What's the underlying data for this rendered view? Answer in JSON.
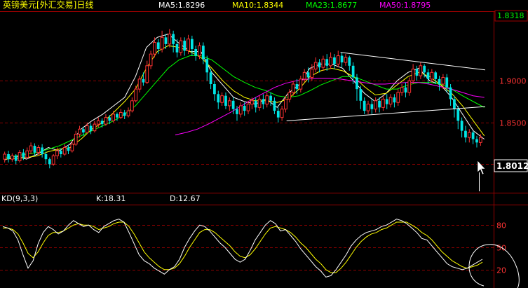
{
  "header": {
    "title": "英镑美元[外汇交易]日线",
    "ma_items": [
      {
        "label": "MA5:1.8296",
        "color": "#ffffff"
      },
      {
        "label": "MA10:1.8344",
        "color": "#ffff00"
      },
      {
        "label": "MA23:1.8677",
        "color": "#00ff00"
      },
      {
        "label": "MA50:1.8795",
        "color": "#ff00ff"
      }
    ]
  },
  "kd_header": {
    "name": "KD(9,3,3)",
    "k": "K:18.31",
    "d": "D:12.67"
  },
  "chart_data": [
    {
      "type": "candlestick",
      "price_axis": {
        "ticks": [
          1.9,
          1.85
        ],
        "tick_labels": [
          "1.9000",
          "1.8500"
        ],
        "ylim": [
          1.77,
          1.98
        ]
      },
      "last_price": "1.8318",
      "cursor_price": "1.8012",
      "grid": true,
      "series": [
        {
          "name": "MA5",
          "color": "#ffffff"
        },
        {
          "name": "MA10",
          "color": "#ffff00"
        },
        {
          "name": "MA23",
          "color": "#00ff00"
        },
        {
          "name": "MA50",
          "color": "#ff00ff"
        }
      ],
      "ma_paths": {
        "MA5": [
          [
            1.805,
            1.81,
            1.806,
            1.812,
            1.82,
            1.816,
            1.824,
            1.842,
            1.852,
            1.86,
            1.87,
            1.88,
            1.905,
            1.94,
            1.952,
            1.956,
            1.945,
            1.935,
            1.935,
            1.91,
            1.895,
            1.88,
            1.875,
            1.872,
            1.878,
            1.868,
            1.885,
            1.895,
            1.915,
            1.92,
            1.92,
            1.915,
            1.9,
            1.885,
            1.875,
            1.885,
            1.9,
            1.91,
            1.915,
            1.9,
            1.895,
            1.88,
            1.86,
            1.84,
            1.83
          ]
        ],
        "MA10": [
          [
            1.806,
            1.807,
            1.808,
            1.81,
            1.815,
            1.818,
            1.82,
            1.83,
            1.842,
            1.85,
            1.862,
            1.875,
            1.89,
            1.915,
            1.935,
            1.942,
            1.94,
            1.935,
            1.928,
            1.915,
            1.9,
            1.888,
            1.88,
            1.876,
            1.876,
            1.874,
            1.878,
            1.89,
            1.905,
            1.912,
            1.915,
            1.912,
            1.905,
            1.893,
            1.883,
            1.885,
            1.895,
            1.905,
            1.91,
            1.905,
            1.895,
            1.885,
            1.87,
            1.852,
            1.834
          ]
        ],
        "MA23": [
          [
            1.808,
            1.81,
            1.812,
            1.814,
            1.818,
            1.822,
            1.828,
            1.834,
            1.84,
            1.846,
            1.852,
            1.86,
            1.87,
            1.885,
            1.9,
            1.915,
            1.925,
            1.93,
            1.93,
            1.925,
            1.915,
            1.905,
            1.898,
            1.892,
            1.888,
            1.882,
            1.88,
            1.882,
            1.888,
            1.895,
            1.9,
            1.905,
            1.905,
            1.9,
            1.895,
            1.89,
            1.89,
            1.895,
            1.898,
            1.898,
            1.896,
            1.89,
            1.882,
            1.875,
            1.868
          ]
        ],
        "MA50": [
          [
            1.835,
            1.838,
            1.842,
            1.848,
            1.855,
            1.862,
            1.87,
            1.878,
            1.885,
            1.892,
            1.897,
            1.9,
            1.902,
            1.903,
            1.903,
            1.902,
            1.9,
            1.898,
            1.896,
            1.896,
            1.897,
            1.898,
            1.898,
            1.896,
            1.893,
            1.89,
            1.886,
            1.882,
            1.88
          ]
        ]
      },
      "ma_start_index": {
        "MA5": 0,
        "MA10": 0,
        "MA23": 0,
        "MA50": 16
      },
      "candles": [
        [
          1.806,
          1.812,
          1.802,
          1.815
        ],
        [
          1.812,
          1.806,
          1.802,
          1.816
        ],
        [
          1.806,
          1.81,
          1.803,
          1.813
        ],
        [
          1.81,
          1.804,
          1.8,
          1.812
        ],
        [
          1.804,
          1.814,
          1.802,
          1.817
        ],
        [
          1.814,
          1.808,
          1.805,
          1.818
        ],
        [
          1.808,
          1.816,
          1.806,
          1.82
        ],
        [
          1.816,
          1.822,
          1.812,
          1.826
        ],
        [
          1.822,
          1.814,
          1.81,
          1.825
        ],
        [
          1.814,
          1.82,
          1.81,
          1.823
        ],
        [
          1.82,
          1.812,
          1.808,
          1.824
        ],
        [
          1.812,
          1.806,
          1.8,
          1.815
        ],
        [
          1.806,
          1.8,
          1.795,
          1.808
        ],
        [
          1.8,
          1.81,
          1.798,
          1.812
        ],
        [
          1.81,
          1.816,
          1.806,
          1.82
        ],
        [
          1.816,
          1.812,
          1.808,
          1.819
        ],
        [
          1.812,
          1.82,
          1.81,
          1.824
        ],
        [
          1.82,
          1.816,
          1.812,
          1.823
        ],
        [
          1.816,
          1.824,
          1.814,
          1.828
        ],
        [
          1.824,
          1.836,
          1.822,
          1.84
        ],
        [
          1.836,
          1.842,
          1.832,
          1.846
        ],
        [
          1.842,
          1.838,
          1.834,
          1.845
        ],
        [
          1.838,
          1.846,
          1.836,
          1.85
        ],
        [
          1.846,
          1.84,
          1.836,
          1.849
        ],
        [
          1.84,
          1.848,
          1.838,
          1.852
        ],
        [
          1.848,
          1.852,
          1.844,
          1.856
        ],
        [
          1.852,
          1.848,
          1.844,
          1.855
        ],
        [
          1.848,
          1.856,
          1.846,
          1.86
        ],
        [
          1.856,
          1.852,
          1.848,
          1.859
        ],
        [
          1.852,
          1.86,
          1.85,
          1.864
        ],
        [
          1.86,
          1.856,
          1.852,
          1.862
        ],
        [
          1.856,
          1.862,
          1.854,
          1.866
        ],
        [
          1.862,
          1.858,
          1.854,
          1.865
        ],
        [
          1.858,
          1.864,
          1.856,
          1.868
        ],
        [
          1.864,
          1.876,
          1.862,
          1.88
        ],
        [
          1.876,
          1.89,
          1.874,
          1.894
        ],
        [
          1.89,
          1.902,
          1.886,
          1.906
        ],
        [
          1.902,
          1.898,
          1.894,
          1.91
        ],
        [
          1.898,
          1.918,
          1.896,
          1.924
        ],
        [
          1.918,
          1.932,
          1.914,
          1.936
        ],
        [
          1.932,
          1.946,
          1.928,
          1.952
        ],
        [
          1.946,
          1.938,
          1.932,
          1.95
        ],
        [
          1.938,
          1.952,
          1.934,
          1.96
        ],
        [
          1.952,
          1.944,
          1.938,
          1.956
        ],
        [
          1.944,
          1.956,
          1.94,
          1.962
        ],
        [
          1.956,
          1.944,
          1.934,
          1.96
        ],
        [
          1.944,
          1.934,
          1.928,
          1.95
        ],
        [
          1.934,
          1.948,
          1.93,
          1.952
        ],
        [
          1.948,
          1.936,
          1.93,
          1.952
        ],
        [
          1.936,
          1.95,
          1.932,
          1.955
        ],
        [
          1.95,
          1.938,
          1.93,
          1.954
        ],
        [
          1.938,
          1.93,
          1.924,
          1.942
        ],
        [
          1.93,
          1.942,
          1.926,
          1.946
        ],
        [
          1.942,
          1.926,
          1.92,
          1.946
        ],
        [
          1.926,
          1.91,
          1.9,
          1.93
        ],
        [
          1.91,
          1.896,
          1.89,
          1.914
        ],
        [
          1.896,
          1.884,
          1.876,
          1.9
        ],
        [
          1.884,
          1.874,
          1.866,
          1.888
        ],
        [
          1.874,
          1.882,
          1.87,
          1.886
        ],
        [
          1.882,
          1.87,
          1.866,
          1.886
        ],
        [
          1.87,
          1.876,
          1.864,
          1.88
        ],
        [
          1.876,
          1.866,
          1.86,
          1.88
        ],
        [
          1.866,
          1.86,
          1.852,
          1.87
        ],
        [
          1.86,
          1.87,
          1.856,
          1.874
        ],
        [
          1.87,
          1.864,
          1.858,
          1.874
        ],
        [
          1.864,
          1.872,
          1.86,
          1.876
        ],
        [
          1.872,
          1.876,
          1.866,
          1.88
        ],
        [
          1.876,
          1.868,
          1.862,
          1.88
        ],
        [
          1.868,
          1.878,
          1.864,
          1.882
        ],
        [
          1.878,
          1.872,
          1.866,
          1.884
        ],
        [
          1.872,
          1.882,
          1.868,
          1.886
        ],
        [
          1.882,
          1.876,
          1.87,
          1.886
        ],
        [
          1.876,
          1.864,
          1.86,
          1.88
        ],
        [
          1.864,
          1.856,
          1.85,
          1.868
        ],
        [
          1.856,
          1.866,
          1.852,
          1.87
        ],
        [
          1.866,
          1.878,
          1.862,
          1.882
        ],
        [
          1.878,
          1.886,
          1.874,
          1.89
        ],
        [
          1.886,
          1.896,
          1.882,
          1.9
        ],
        [
          1.896,
          1.89,
          1.884,
          1.902
        ],
        [
          1.89,
          1.902,
          1.886,
          1.906
        ],
        [
          1.902,
          1.91,
          1.898,
          1.914
        ],
        [
          1.91,
          1.904,
          1.898,
          1.916
        ],
        [
          1.904,
          1.914,
          1.9,
          1.92
        ],
        [
          1.914,
          1.922,
          1.91,
          1.928
        ],
        [
          1.922,
          1.916,
          1.91,
          1.926
        ],
        [
          1.916,
          1.926,
          1.912,
          1.93
        ],
        [
          1.926,
          1.918,
          1.912,
          1.932
        ],
        [
          1.918,
          1.928,
          1.914,
          1.934
        ],
        [
          1.928,
          1.92,
          1.914,
          1.932
        ],
        [
          1.92,
          1.93,
          1.916,
          1.936
        ],
        [
          1.93,
          1.922,
          1.916,
          1.934
        ],
        [
          1.922,
          1.928,
          1.918,
          1.932
        ],
        [
          1.928,
          1.918,
          1.912,
          1.93
        ],
        [
          1.918,
          1.904,
          1.896,
          1.922
        ],
        [
          1.904,
          1.89,
          1.876,
          1.908
        ],
        [
          1.89,
          1.876,
          1.866,
          1.894
        ],
        [
          1.876,
          1.864,
          1.86,
          1.88
        ],
        [
          1.864,
          1.872,
          1.86,
          1.876
        ],
        [
          1.872,
          1.866,
          1.86,
          1.878
        ],
        [
          1.866,
          1.876,
          1.862,
          1.88
        ],
        [
          1.876,
          1.868,
          1.862,
          1.88
        ],
        [
          1.868,
          1.878,
          1.864,
          1.882
        ],
        [
          1.878,
          1.872,
          1.866,
          1.884
        ],
        [
          1.872,
          1.88,
          1.868,
          1.884
        ],
        [
          1.88,
          1.874,
          1.868,
          1.884
        ],
        [
          1.874,
          1.886,
          1.87,
          1.89
        ],
        [
          1.886,
          1.892,
          1.882,
          1.896
        ],
        [
          1.892,
          1.886,
          1.88,
          1.898
        ],
        [
          1.886,
          1.9,
          1.882,
          1.904
        ],
        [
          1.9,
          1.914,
          1.896,
          1.92
        ],
        [
          1.914,
          1.906,
          1.9,
          1.918
        ],
        [
          1.906,
          1.918,
          1.902,
          1.922
        ],
        [
          1.918,
          1.91,
          1.904,
          1.92
        ],
        [
          1.91,
          1.902,
          1.896,
          1.914
        ],
        [
          1.902,
          1.91,
          1.898,
          1.914
        ],
        [
          1.91,
          1.902,
          1.896,
          1.912
        ],
        [
          1.902,
          1.896,
          1.888,
          1.906
        ],
        [
          1.896,
          1.904,
          1.89,
          1.908
        ],
        [
          1.904,
          1.892,
          1.886,
          1.908
        ],
        [
          1.892,
          1.878,
          1.87,
          1.896
        ],
        [
          1.878,
          1.866,
          1.856,
          1.882
        ],
        [
          1.866,
          1.852,
          1.842,
          1.87
        ],
        [
          1.852,
          1.84,
          1.832,
          1.856
        ],
        [
          1.84,
          1.832,
          1.826,
          1.846
        ],
        [
          1.832,
          1.838,
          1.826,
          1.842
        ],
        [
          1.838,
          1.83,
          1.824,
          1.84
        ],
        [
          1.83,
          1.826,
          1.82,
          1.834
        ],
        [
          1.826,
          1.832,
          1.822,
          1.836
        ]
      ],
      "trendlines": [
        {
          "from": [
            119,
            1.934
          ],
          "to": [
            170,
            1.913
          ]
        },
        {
          "from": [
            100,
            1.852
          ],
          "to": [
            170,
            1.869
          ]
        }
      ]
    },
    {
      "type": "line",
      "name": "KD(9,3,3)",
      "y_ticks": [
        80,
        50,
        20
      ],
      "ylim": [
        0,
        100
      ],
      "k_color": "#ffffff",
      "d_color": "#ffff00",
      "K": [
        78,
        76,
        72,
        60,
        40,
        22,
        32,
        55,
        70,
        78,
        74,
        68,
        72,
        80,
        86,
        82,
        78,
        80,
        74,
        70,
        78,
        82,
        86,
        88,
        84,
        70,
        55,
        40,
        32,
        28,
        22,
        18,
        14,
        20,
        24,
        34,
        50,
        62,
        72,
        80,
        78,
        72,
        64,
        56,
        50,
        42,
        34,
        30,
        34,
        46,
        60,
        70,
        80,
        86,
        82,
        72,
        74,
        66,
        58,
        48,
        40,
        32,
        24,
        18,
        10,
        12,
        20,
        30,
        40,
        52,
        60,
        66,
        70,
        72,
        74,
        78,
        80,
        84,
        88,
        86,
        82,
        76,
        70,
        62,
        60,
        52,
        44,
        36,
        28,
        24,
        22,
        20,
        22,
        26,
        30,
        34
      ],
      "D": [
        76,
        76,
        74,
        68,
        56,
        42,
        36,
        44,
        56,
        66,
        70,
        70,
        72,
        76,
        80,
        82,
        80,
        80,
        78,
        74,
        76,
        78,
        82,
        84,
        84,
        78,
        68,
        56,
        44,
        36,
        30,
        24,
        20,
        20,
        22,
        28,
        38,
        50,
        60,
        70,
        74,
        74,
        70,
        64,
        58,
        52,
        44,
        38,
        36,
        40,
        48,
        58,
        68,
        76,
        78,
        76,
        74,
        70,
        64,
        56,
        50,
        42,
        34,
        28,
        20,
        16,
        16,
        22,
        30,
        40,
        50,
        58,
        64,
        68,
        70,
        74,
        76,
        80,
        84,
        84,
        84,
        80,
        76,
        70,
        66,
        60,
        52,
        44,
        38,
        32,
        28,
        24,
        22,
        24,
        26,
        30
      ]
    }
  ]
}
